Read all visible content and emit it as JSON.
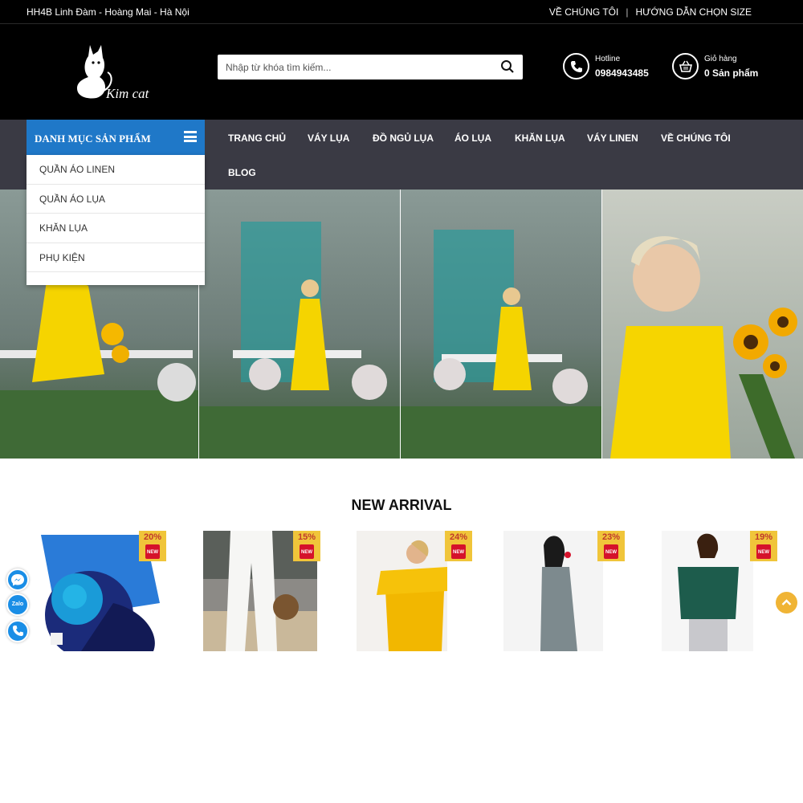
{
  "topbar": {
    "address": "HH4B Linh Đàm - Hoàng Mai - Hà Nội",
    "about_link": "VỀ CHÚNG TÔI",
    "separator": "|",
    "size_guide_link": "HƯỚNG DẪN CHỌN SIZE"
  },
  "header": {
    "logo_text": "Kim cat",
    "search": {
      "placeholder": "Nhập từ khóa tìm kiếm..."
    },
    "hotline": {
      "label": "Hotline",
      "value": "0984943485"
    },
    "cart": {
      "label": "Giỏ hàng",
      "value": "0 Sản phẩm"
    }
  },
  "nav": {
    "category_title": "DANH MỤC SẢN PHẨM",
    "items": [
      "TRANG CHỦ",
      "VÁY LỤA",
      "ĐỒ NGỦ LỤA",
      "ÁO LỤA",
      "KHĂN LỤA",
      "VÁY LINEN",
      "VỀ CHÚNG TÔI",
      "BLOG"
    ],
    "categories": [
      "QUẦN ÁO LINEN",
      "QUẦN ÁO LỤA",
      "KHĂN LỤA",
      "PHỤ KIỆN"
    ]
  },
  "new_arrival": {
    "title": "NEW ARRIVAL",
    "products": [
      {
        "discount": "20%",
        "badge": "NEW"
      },
      {
        "discount": "15%",
        "badge": "NEW"
      },
      {
        "discount": "24%",
        "badge": "NEW"
      },
      {
        "discount": "23%",
        "badge": "NEW"
      },
      {
        "discount": "19%",
        "badge": "NEW"
      }
    ]
  },
  "contact_widgets": {
    "zalo_label": "Zalo"
  },
  "colors": {
    "header_bg": "#000000",
    "nav_bg": "#3a3a44",
    "category_bg": "#1f78c8",
    "tag_bg": "#f0c53a",
    "new_badge": "#d5122b",
    "scroll_top": "#f0b435"
  }
}
